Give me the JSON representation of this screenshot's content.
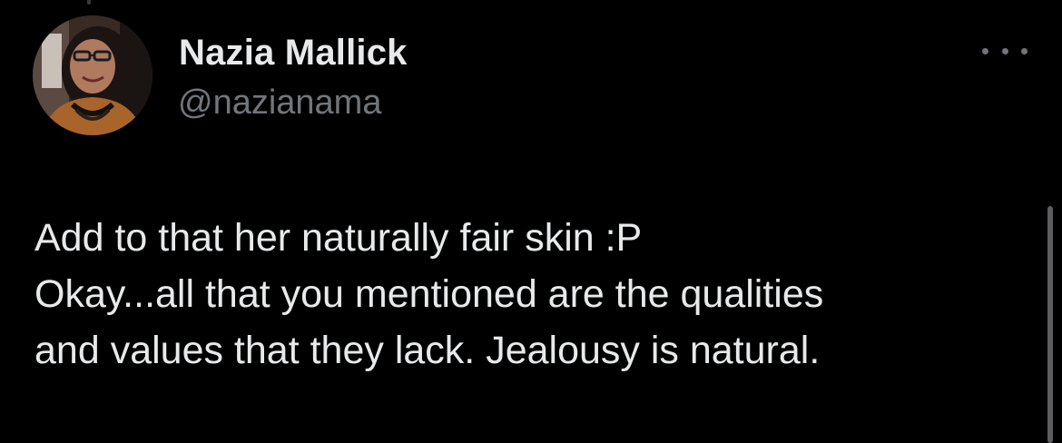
{
  "author": {
    "name": "Nazia Mallick",
    "handle": "@nazianama"
  },
  "tweet": {
    "lines": [
      "Add to that her naturally fair skin :P",
      "Okay...all that you mentioned are the qualities",
      "and values that they lack. Jealousy is natural."
    ]
  },
  "icons": {
    "more": "more-horizontal-icon"
  },
  "colors": {
    "background": "#000000",
    "text_primary": "#e7e9ea",
    "text_secondary": "#71767b"
  }
}
